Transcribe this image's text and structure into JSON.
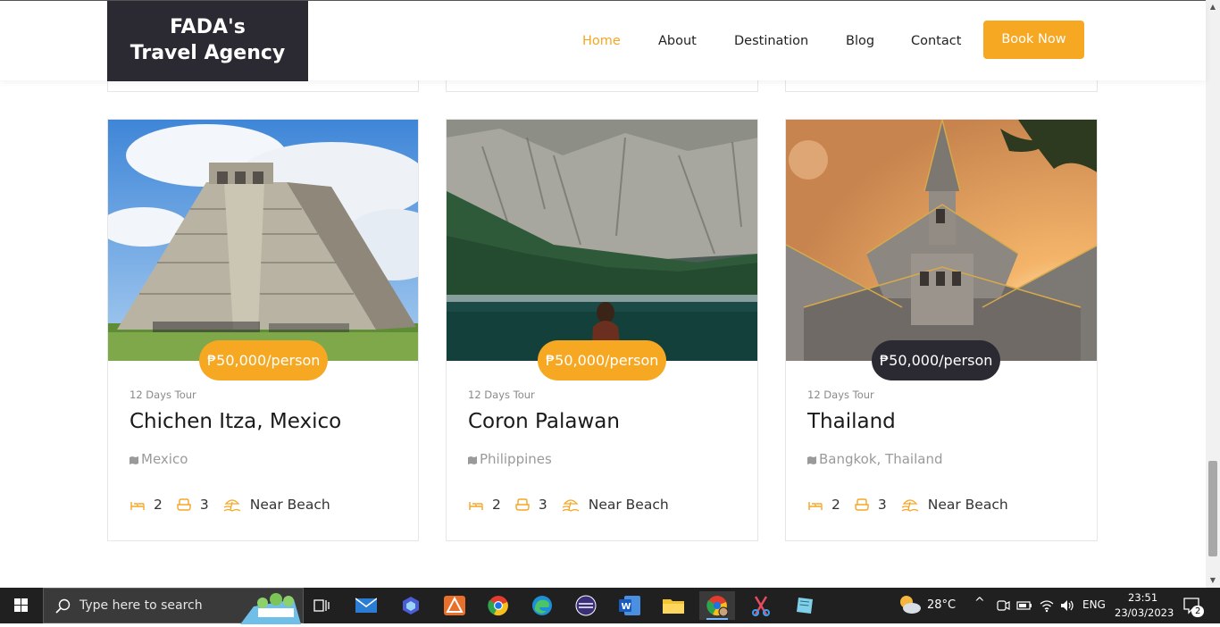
{
  "brand": {
    "line1": "FADA's",
    "line2": "Travel Agency"
  },
  "nav": {
    "items": [
      {
        "label": "Home",
        "active": true
      },
      {
        "label": "About",
        "active": false
      },
      {
        "label": "Destination",
        "active": false
      },
      {
        "label": "Blog",
        "active": false
      },
      {
        "label": "Contact",
        "active": false
      }
    ],
    "cta": "Book Now"
  },
  "colors": {
    "accent": "#f7a823",
    "dark": "#2b2a33"
  },
  "tours": [
    {
      "price": "₱50,000/person",
      "price_style": "accent",
      "duration": "12 Days Tour",
      "title": "Chichen Itza, Mexico",
      "location": "Mexico",
      "rooms": "2",
      "baths": "3",
      "feature": "Near Beach"
    },
    {
      "price": "₱50,000/person",
      "price_style": "accent",
      "duration": "12 Days Tour",
      "title": "Coron Palawan",
      "location": "Philippines",
      "rooms": "2",
      "baths": "3",
      "feature": "Near Beach"
    },
    {
      "price": "₱50,000/person",
      "price_style": "dark",
      "duration": "12 Days Tour",
      "title": "Thailand",
      "location": "Bangkok, Thailand",
      "rooms": "2",
      "baths": "3",
      "feature": "Near Beach"
    }
  ],
  "taskbar": {
    "search_placeholder": "Type here to search",
    "weather": "28°C",
    "language": "ENG",
    "time": "23:51",
    "date": "23/03/2023",
    "notification_count": "2",
    "apps": [
      "task-view",
      "mail",
      "copilot",
      "office-app",
      "chrome",
      "edge",
      "media-app",
      "word",
      "file-explorer",
      "chrome-profile",
      "snipping-tool",
      "notes-app"
    ]
  }
}
